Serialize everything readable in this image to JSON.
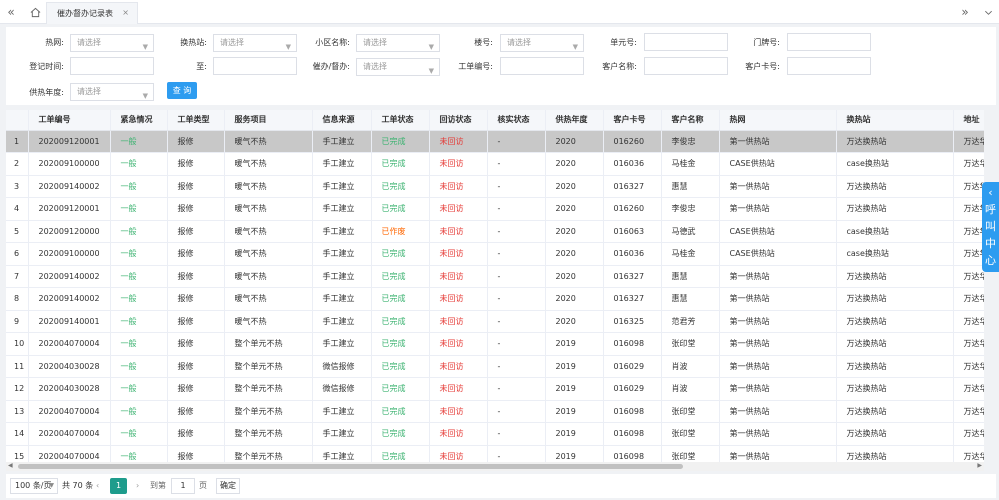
{
  "topbar": {
    "tab_label": "催办督办记录表",
    "tab_close": "×"
  },
  "filters": {
    "heat_network": {
      "label": "热网:",
      "placeholder": "请选择"
    },
    "exchange_station": {
      "label": "换热站:",
      "placeholder": "请选择"
    },
    "community": {
      "label": "小区名称:",
      "placeholder": "请选择"
    },
    "building": {
      "label": "楼号:",
      "placeholder": "请选择"
    },
    "unit": {
      "label": "单元号:",
      "value": ""
    },
    "door": {
      "label": "门牌号:",
      "value": ""
    },
    "reg_time": {
      "label": "登记时间:",
      "value": ""
    },
    "to": {
      "label": "至:",
      "value": ""
    },
    "urge_type": {
      "label": "催办/督办:",
      "placeholder": "请选择"
    },
    "order_no": {
      "label": "工单编号:",
      "value": ""
    },
    "customer_name": {
      "label": "客户名称:",
      "value": ""
    },
    "customer_card": {
      "label": "客户卡号:",
      "value": ""
    },
    "season": {
      "label": "供热年度:",
      "placeholder": "请选择"
    },
    "query_label": "查 询"
  },
  "table": {
    "columns": [
      "",
      "工单编号",
      "紧急情况",
      "工单类型",
      "服务项目",
      "信息来源",
      "工单状态",
      "回访状态",
      "核实状态",
      "供热年度",
      "客户卡号",
      "客户名称",
      "热网",
      "换热站",
      "地址"
    ],
    "rows": [
      [
        "1",
        "202009120001",
        "一般",
        "报修",
        "暖气不热",
        "手工建立",
        "已完成",
        "未回访",
        "-",
        "2020",
        "016260",
        "李俊忠",
        "第一供热站",
        "万达换热站",
        "万达华"
      ],
      [
        "2",
        "202009100000",
        "一般",
        "报修",
        "暖气不热",
        "手工建立",
        "已完成",
        "未回访",
        "-",
        "2020",
        "016036",
        "马桂金",
        "CASE供热站",
        "case换热站",
        "万达华"
      ],
      [
        "3",
        "202009140002",
        "一般",
        "报修",
        "暖气不热",
        "手工建立",
        "已完成",
        "未回访",
        "-",
        "2020",
        "016327",
        "惠慧",
        "第一供热站",
        "万达换热站",
        "万达华"
      ],
      [
        "4",
        "202009120001",
        "一般",
        "报修",
        "暖气不热",
        "手工建立",
        "已完成",
        "未回访",
        "-",
        "2020",
        "016260",
        "李俊忠",
        "第一供热站",
        "万达换热站",
        "万达华"
      ],
      [
        "5",
        "202009120000",
        "一般",
        "报修",
        "暖气不热",
        "手工建立",
        "已作废",
        "未回访",
        "-",
        "2020",
        "016063",
        "马德武",
        "CASE供热站",
        "case换热站",
        "万达华"
      ],
      [
        "6",
        "202009100000",
        "一般",
        "报修",
        "暖气不热",
        "手工建立",
        "已完成",
        "未回访",
        "-",
        "2020",
        "016036",
        "马桂金",
        "CASE供热站",
        "case换热站",
        "万达华"
      ],
      [
        "7",
        "202009140002",
        "一般",
        "报修",
        "暖气不热",
        "手工建立",
        "已完成",
        "未回访",
        "-",
        "2020",
        "016327",
        "惠慧",
        "第一供热站",
        "万达换热站",
        "万达华"
      ],
      [
        "8",
        "202009140002",
        "一般",
        "报修",
        "暖气不热",
        "手工建立",
        "已完成",
        "未回访",
        "-",
        "2020",
        "016327",
        "惠慧",
        "第一供热站",
        "万达换热站",
        "万达华"
      ],
      [
        "9",
        "202009140001",
        "一般",
        "报修",
        "暖气不热",
        "手工建立",
        "已完成",
        "未回访",
        "-",
        "2020",
        "016325",
        "范君芳",
        "第一供热站",
        "万达换热站",
        "万达华"
      ],
      [
        "10",
        "202004070004",
        "一般",
        "报修",
        "整个单元不热",
        "手工建立",
        "已完成",
        "未回访",
        "-",
        "2019",
        "016098",
        "张印堂",
        "第一供热站",
        "万达换热站",
        "万达华"
      ],
      [
        "11",
        "202004030028",
        "一般",
        "报修",
        "整个单元不热",
        "微信报修",
        "已完成",
        "未回访",
        "-",
        "2019",
        "016029",
        "肖波",
        "第一供热站",
        "万达换热站",
        "万达华"
      ],
      [
        "12",
        "202004030028",
        "一般",
        "报修",
        "整个单元不热",
        "微信报修",
        "已完成",
        "未回访",
        "-",
        "2019",
        "016029",
        "肖波",
        "第一供热站",
        "万达换热站",
        "万达华"
      ],
      [
        "13",
        "202004070004",
        "一般",
        "报修",
        "整个单元不热",
        "手工建立",
        "已完成",
        "未回访",
        "-",
        "2019",
        "016098",
        "张印堂",
        "第一供热站",
        "万达换热站",
        "万达华"
      ],
      [
        "14",
        "202004070004",
        "一般",
        "报修",
        "整个单元不热",
        "手工建立",
        "已完成",
        "未回访",
        "-",
        "2019",
        "016098",
        "张印堂",
        "第一供热站",
        "万达换热站",
        "万达华"
      ],
      [
        "15",
        "202004070004",
        "一般",
        "报修",
        "整个单元不热",
        "手工建立",
        "已完成",
        "未回访",
        "-",
        "2019",
        "016098",
        "张印堂",
        "第一供热站",
        "万达换热站",
        "万达华"
      ]
    ]
  },
  "pager": {
    "page_size": "100 条/页",
    "total": "共 70 条",
    "current": "1",
    "goto_label": "到第",
    "goto_value": "1",
    "page_unit": "页",
    "confirm": "确定"
  },
  "callcenter": {
    "arrow": "‹",
    "chars": [
      "呼",
      "叫",
      "中",
      "心"
    ]
  },
  "colors": {
    "accent": "#2d9cf0",
    "pager_active": "#1e9c8c",
    "status_green": "#3cb371",
    "status_red": "#e53935",
    "status_orange": "#ff6600"
  }
}
